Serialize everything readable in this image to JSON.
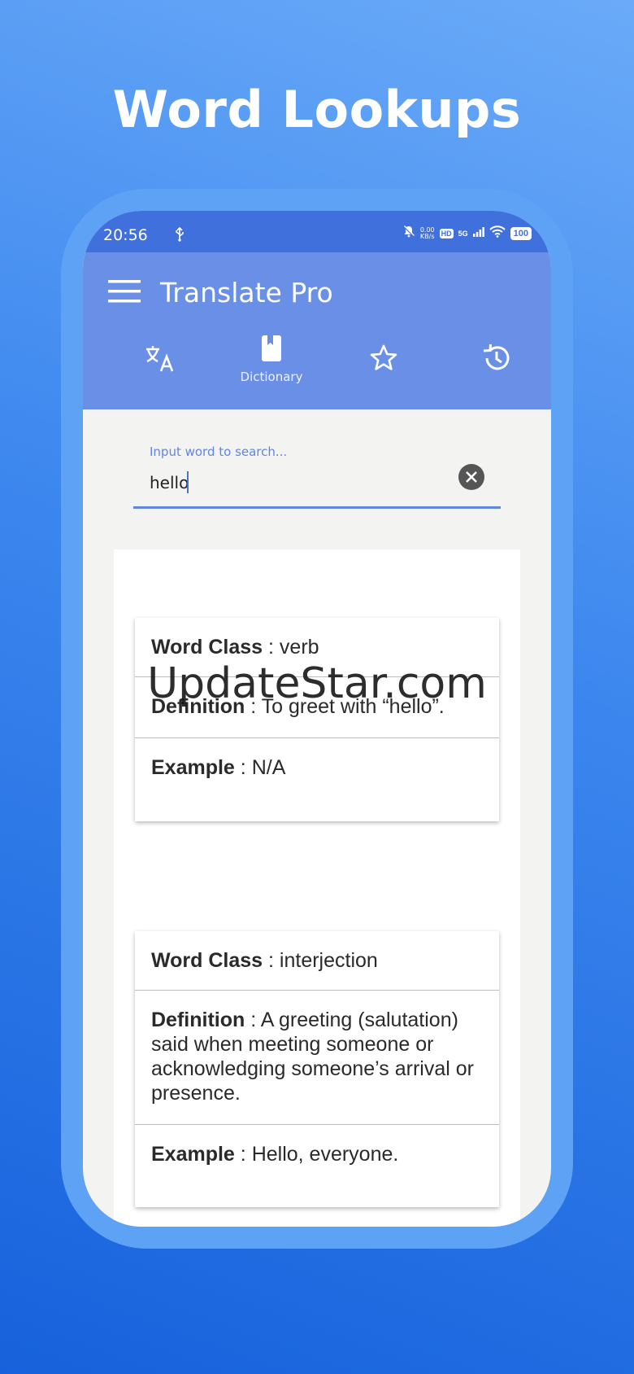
{
  "headline": "Word Lookups",
  "status": {
    "time": "20:56",
    "netspeed_value": "0.00",
    "netspeed_unit": "KB/s",
    "hd": "HD",
    "network": "5G",
    "battery": "100"
  },
  "app": {
    "title": "Translate Pro",
    "tabs": [
      {
        "icon": "translate-icon",
        "label": ""
      },
      {
        "icon": "book-icon",
        "label": "Dictionary"
      },
      {
        "icon": "star-icon",
        "label": ""
      },
      {
        "icon": "history-icon",
        "label": ""
      }
    ],
    "active_tab": "Dictionary"
  },
  "search": {
    "label": "Input word to search...",
    "value": "hello"
  },
  "entries": [
    {
      "word_class_key": "Word Class",
      "word_class": "verb",
      "definition_key": "Definition",
      "definition": "To greet with “hello”.",
      "example_key": "Example",
      "example": "N/A"
    },
    {
      "word_class_key": "Word Class",
      "word_class": "interjection",
      "definition_key": "Definition",
      "definition": "A greeting (salutation) said when meeting someone or acknowledging someone’s arrival or presence.",
      "example_key": "Example",
      "example": "Hello, everyone."
    }
  ],
  "watermark": "UpdateStar.com",
  "colors": {
    "status_bar": "#3f70db",
    "app_bar": "#6a8fe6",
    "accent": "#5f86e0"
  }
}
